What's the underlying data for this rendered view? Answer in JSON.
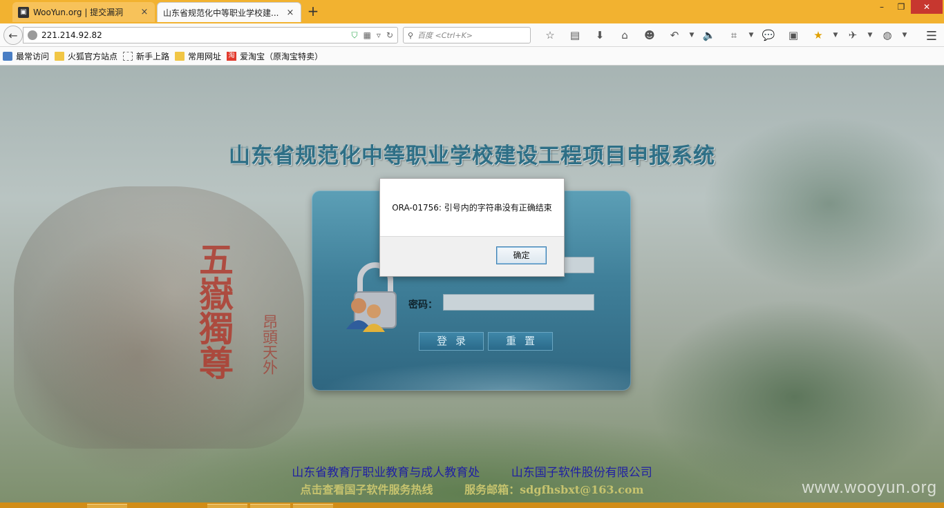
{
  "browser": {
    "tabs": [
      {
        "title": "WooYun.org | 提交漏洞",
        "close": "×"
      },
      {
        "title": "山东省规范化中等职业学校建...",
        "close": "×"
      }
    ],
    "new_tab": "+",
    "window_controls": {
      "minimize": "–",
      "maximize": "❐",
      "close": "✕"
    },
    "url": "221.214.92.82",
    "search_placeholder": "百度 <Ctrl+K>",
    "bookmarks": [
      {
        "label": "最常访问",
        "icon": "star-icon"
      },
      {
        "label": "火狐官方站点",
        "icon": "folder-icon"
      },
      {
        "label": "新手上路",
        "icon": "page-icon"
      },
      {
        "label": "常用网址",
        "icon": "folder-icon"
      },
      {
        "label": "爱淘宝（原淘宝特卖）",
        "icon": "taobao-icon",
        "badge": "淘"
      }
    ]
  },
  "page": {
    "system_title": "山东省规范化中等职业学校建设工程项目申报系统",
    "rock_inscription": "五嶽獨尊",
    "rock_inscription_small": "昂頭天外",
    "password_label": "密码：",
    "login_button": "登录",
    "reset_button": "重置",
    "footer_org": "山东省教育厅职业教育与成人教育处",
    "footer_company": "山东国子软件股份有限公司",
    "footer_hotline": "点击查看国子软件服务热线",
    "footer_email": "服务邮箱：sdgfhsbxt@163.com",
    "watermark": "www.wooyun.org"
  },
  "dialog": {
    "message": "ORA-01756: 引号内的字符串没有正确结束",
    "ok_label": "确定"
  },
  "colors": {
    "tabbar": "#f2b230",
    "title_teal": "#2e6f86",
    "footer_blue": "#1f1fa3",
    "footer_gold": "#c6c36e",
    "panel": "#3f7f99"
  }
}
